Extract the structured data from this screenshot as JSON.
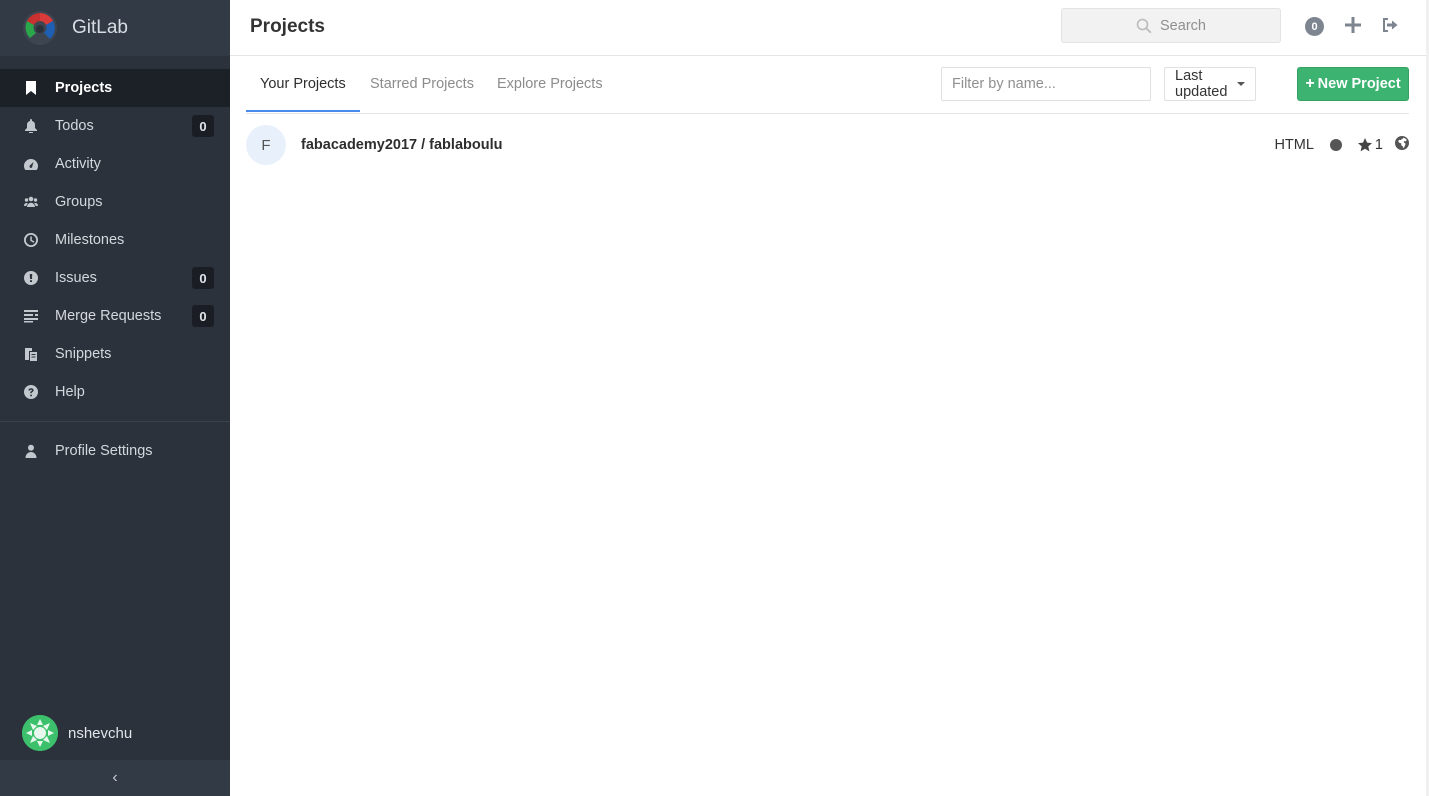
{
  "app": {
    "title": "GitLab"
  },
  "sidebar": {
    "items": [
      {
        "label": "Projects",
        "icon": "bookmark-icon",
        "active": true,
        "badge": null
      },
      {
        "label": "Todos",
        "icon": "bell-icon",
        "badge": "0"
      },
      {
        "label": "Activity",
        "icon": "dashboard-icon",
        "badge": null
      },
      {
        "label": "Groups",
        "icon": "users-icon",
        "badge": null
      },
      {
        "label": "Milestones",
        "icon": "clock-icon",
        "badge": null
      },
      {
        "label": "Issues",
        "icon": "exclamation-circle-icon",
        "badge": "0"
      },
      {
        "label": "Merge Requests",
        "icon": "list-icon",
        "badge": "0"
      },
      {
        "label": "Snippets",
        "icon": "clipboard-icon",
        "badge": null
      },
      {
        "label": "Help",
        "icon": "question-circle-icon",
        "badge": null
      }
    ],
    "profile_settings": {
      "label": "Profile Settings",
      "icon": "user-icon"
    },
    "user": {
      "name": "nshevchu"
    },
    "collapse_label": "‹"
  },
  "header": {
    "title": "Projects",
    "search_placeholder": "Search",
    "todo_count": "0"
  },
  "tabs": [
    {
      "label": "Your Projects",
      "active": true
    },
    {
      "label": "Starred Projects",
      "active": false
    },
    {
      "label": "Explore Projects",
      "active": false
    }
  ],
  "filter": {
    "placeholder": "Filter by name..."
  },
  "sort": {
    "label": "Last updated"
  },
  "new_project": {
    "label": "New Project"
  },
  "projects": [
    {
      "avatar_letter": "F",
      "name": "fabacademy2017 / fablaboulu",
      "language": "HTML",
      "stars": "1"
    }
  ],
  "colors": {
    "sidebar_bg": "#2b323c",
    "accent_green": "#3cb371",
    "tab_active": "#4a8bee"
  }
}
